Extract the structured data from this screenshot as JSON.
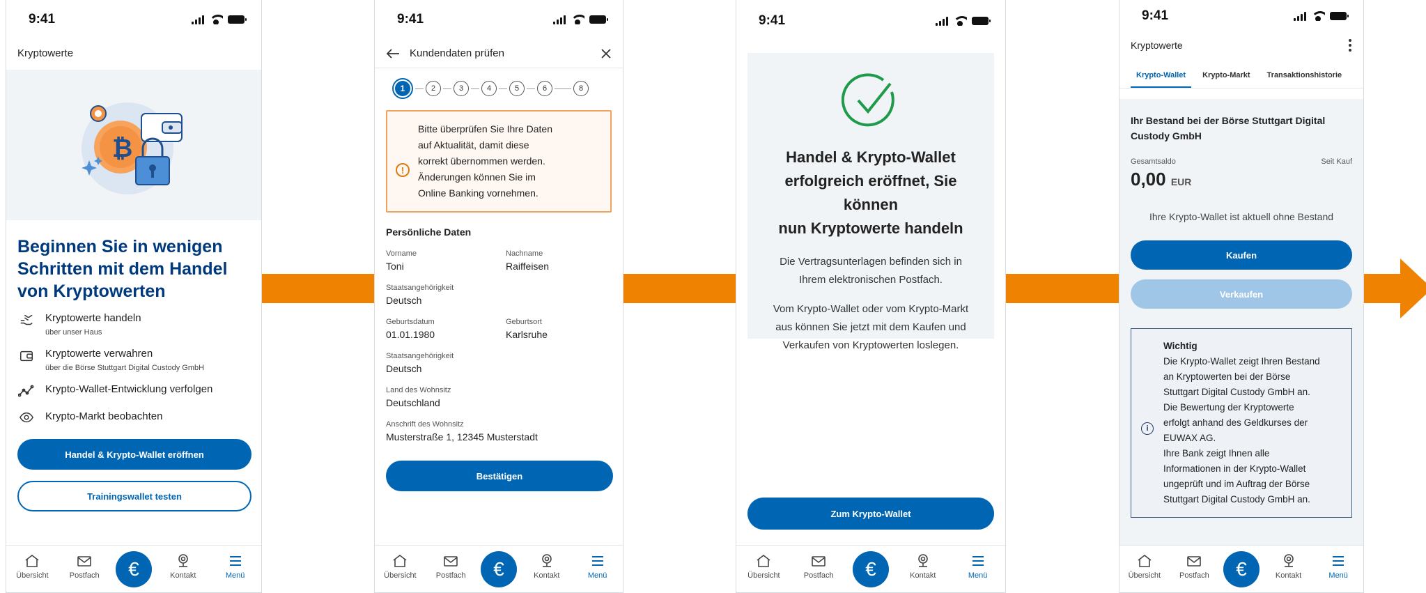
{
  "status_time": "9:41",
  "tabbar": {
    "overview": "Übersicht",
    "mail": "Postfach",
    "euro": "€",
    "contact": "Kontakt",
    "menu": "Menü"
  },
  "screen1": {
    "title": "Kryptowerte",
    "headline": "Beginnen Sie in wenigen Schritten mit dem Handel von Kryptowerten",
    "features": [
      {
        "icon": "trade-hand-icon",
        "title": "Kryptowerte handeln",
        "sub": "über unser Haus"
      },
      {
        "icon": "wallet-icon",
        "title": "Kryptowerte verwahren",
        "sub": "über die Börse Stuttgart Digital Custody GmbH"
      },
      {
        "icon": "chart-line-icon",
        "title": "Krypto-Wallet-Entwicklung verfolgen",
        "sub": ""
      },
      {
        "icon": "eye-icon",
        "title": "Krypto-Markt beobachten",
        "sub": ""
      }
    ],
    "primary_button": "Handel & Krypto-Wallet eröffnen",
    "secondary_button": "Trainingswallet testen"
  },
  "screen2": {
    "title": "Kundendaten prüfen",
    "steps": [
      "1",
      "2",
      "3",
      "4",
      "5",
      "6",
      "8"
    ],
    "current_step": "1",
    "notice_lines": [
      "Bitte überprüfen Sie Ihre Daten",
      "auf Aktualität, damit diese",
      "korrekt übernommen werden.",
      "Änderungen können Sie im",
      "Online Banking vornehmen."
    ],
    "section_title": "Persönliche Daten",
    "fields": {
      "vorname": {
        "label": "Vorname",
        "value": "Toni"
      },
      "nachname": {
        "label": "Nachname",
        "value": "Raiffeisen"
      },
      "staat1": {
        "label": "Staatsangehörigkeit",
        "value": "Deutsch"
      },
      "geburtsdatum": {
        "label": "Geburtsdatum",
        "value": "01.01.1980"
      },
      "geburtsort": {
        "label": "Geburtsort",
        "value": "Karlsruhe"
      },
      "staat2": {
        "label": "Staatsangehörigkeit",
        "value": "Deutsch"
      },
      "land": {
        "label": "Land des Wohnsitz",
        "value": "Deutschland"
      },
      "anschrift": {
        "label": "Anschrift des Wohnsitz",
        "value": "Musterstraße 1, 12345 Musterstadt"
      }
    },
    "confirm_button": "Bestätigen"
  },
  "screen3": {
    "headline_lines": [
      "Handel & Krypto-Wallet",
      "erfolgreich eröffnet, Sie können",
      "nun Kryptowerte handeln"
    ],
    "para1_lines": [
      "Die Vertragsunterlagen befinden sich in",
      "Ihrem elektronischen Postfach."
    ],
    "para2_lines": [
      "Vom Krypto-Wallet oder vom Krypto-Markt",
      "aus können Sie jetzt mit dem Kaufen und",
      "Verkaufen von Kryptowerten loslegen."
    ],
    "button": "Zum Krypto-Wallet"
  },
  "screen4": {
    "title": "Kryptowerte",
    "tabs": [
      "Krypto-Wallet",
      "Krypto-Markt",
      "Transaktionshistorie"
    ],
    "bestand_title": "Ihr Bestand bei der Börse Stuttgart Digital Custody GmbH",
    "saldo_label": "Gesamtsaldo",
    "since_label": "Seit Kauf",
    "saldo_value": "0,00",
    "saldo_currency": "EUR",
    "empty_text": "Ihre Krypto-Wallet ist aktuell ohne Bestand",
    "buy_button": "Kaufen",
    "sell_button": "Verkaufen",
    "info_title": "Wichtig",
    "info_lines": [
      "Die Krypto-Wallet zeigt Ihren Bestand",
      "an Kryptowerten bei der Börse",
      "Stuttgart Digital Custody GmbH an.",
      "Die Bewertung der Kryptowerte",
      "erfolgt anhand des Geldkurses der",
      "EUWAX AG.",
      "Ihre Bank zeigt Ihnen alle",
      "Informationen in der Krypto-Wallet",
      "ungeprüft und im Auftrag der Börse",
      "Stuttgart Digital Custody GmbH an."
    ]
  },
  "colors": {
    "brand_blue": "#0066b3",
    "headline_blue": "#003a7d",
    "flow_arrow": "#ef8200",
    "success_green": "#1f9a4a",
    "notice_orange": "#e07a10"
  }
}
